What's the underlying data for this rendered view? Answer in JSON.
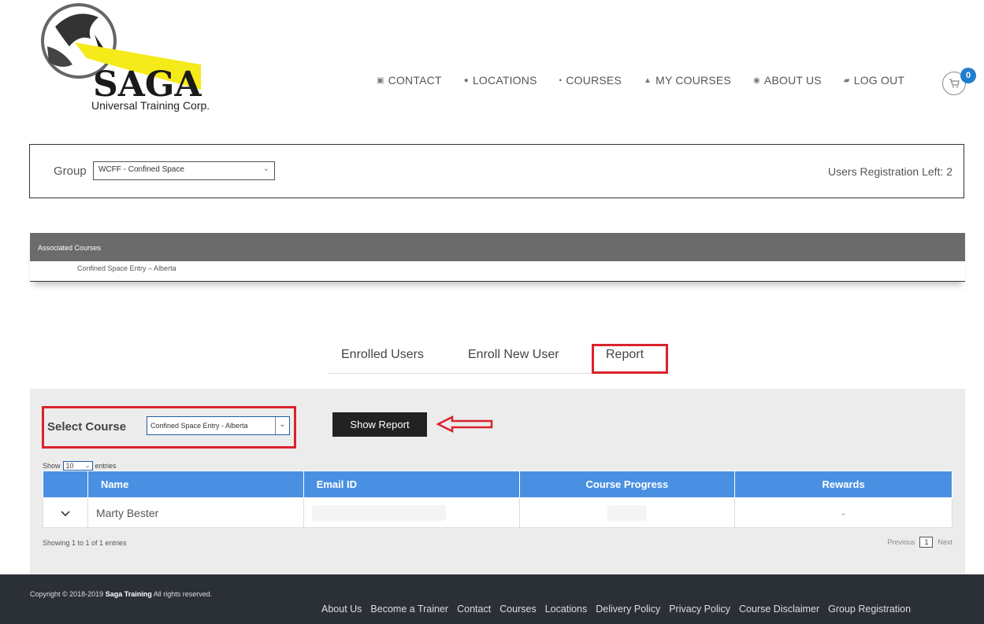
{
  "logo": {
    "brand": "SAGA",
    "subtitle": "Universal Training Corp."
  },
  "nav": [
    {
      "label": "CONTACT",
      "icon": "contact-icon",
      "glyph": "▣"
    },
    {
      "label": "LOCATIONS",
      "icon": "location-pin-icon",
      "glyph": "●"
    },
    {
      "label": "COURSES",
      "icon": "courses-book-icon",
      "glyph": "▪"
    },
    {
      "label": "MY COURSES",
      "icon": "my-courses-icon",
      "glyph": "▲"
    },
    {
      "label": "ABOUT US",
      "icon": "info-icon",
      "glyph": "◉"
    },
    {
      "label": "LOG OUT",
      "icon": "logout-icon",
      "glyph": "▰"
    }
  ],
  "cart": {
    "count": "0"
  },
  "group": {
    "label": "Group",
    "selected": "WCFF - Confined Space",
    "registration_left": "Users Registration Left: 2"
  },
  "associated": {
    "header": "Associated Courses",
    "course": "Confined Space Entry – Alberta"
  },
  "tabs": {
    "enrolled": "Enrolled Users",
    "enroll_new": "Enroll New User",
    "report": "Report"
  },
  "report": {
    "select_label": "Select Course",
    "selected_course": "Confined Space Entry - Alberta",
    "show_button": "Show Report",
    "show_text": "Show",
    "entries_value": "10",
    "entries_text": "entries"
  },
  "table": {
    "headers": [
      "Name",
      "Email ID",
      "Course Progress",
      "Rewards"
    ],
    "rows": [
      {
        "name": "Marty Bester",
        "email": "",
        "progress": "",
        "rewards": "-"
      }
    ],
    "showing": "Showing 1 to 1 of 1 entries",
    "previous": "Previous",
    "page": "1",
    "next": "Next"
  },
  "footer": {
    "copyright_prefix": "Copyright © 2018-2019",
    "brand": "Saga Training",
    "copyright_suffix": "All rights reserved.",
    "links": [
      "About Us",
      "Become a Trainer",
      "Contact",
      "Courses",
      "Locations",
      "Delivery Policy",
      "Privacy Policy",
      "Course Disclaimer",
      "Group Registration"
    ]
  },
  "colors": {
    "accent": "#4a90e2",
    "highlight": "#d9232b",
    "footer": "#2b3037"
  }
}
